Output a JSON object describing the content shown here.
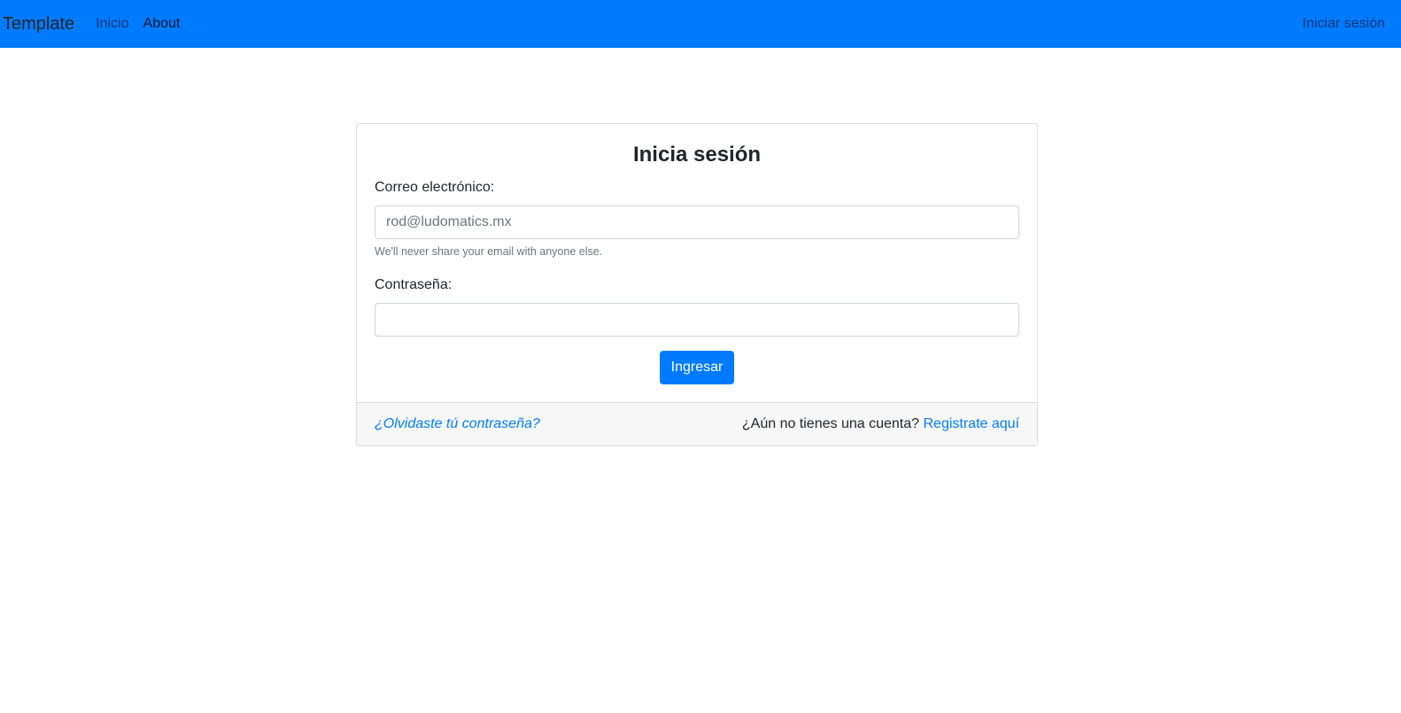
{
  "navbar": {
    "brand": "Template",
    "links": [
      {
        "label": "Inicio"
      },
      {
        "label": "About"
      }
    ],
    "login_link": "Iniciar sesión",
    "background_color": "#007bff"
  },
  "login_card": {
    "title": "Inicia sesión",
    "email": {
      "label": "Correo electrónico:",
      "placeholder": "rod@ludomatics.mx",
      "value": "",
      "help": "We'll never share your email with anyone else."
    },
    "password": {
      "label": "Contraseña:",
      "value": ""
    },
    "submit_label": "Ingresar",
    "footer": {
      "forgot_link": "¿Olvidaste tú contraseña?",
      "no_account_text": "¿Aún no tienes una cuenta?",
      "register_link": "Registrate aquí"
    }
  }
}
